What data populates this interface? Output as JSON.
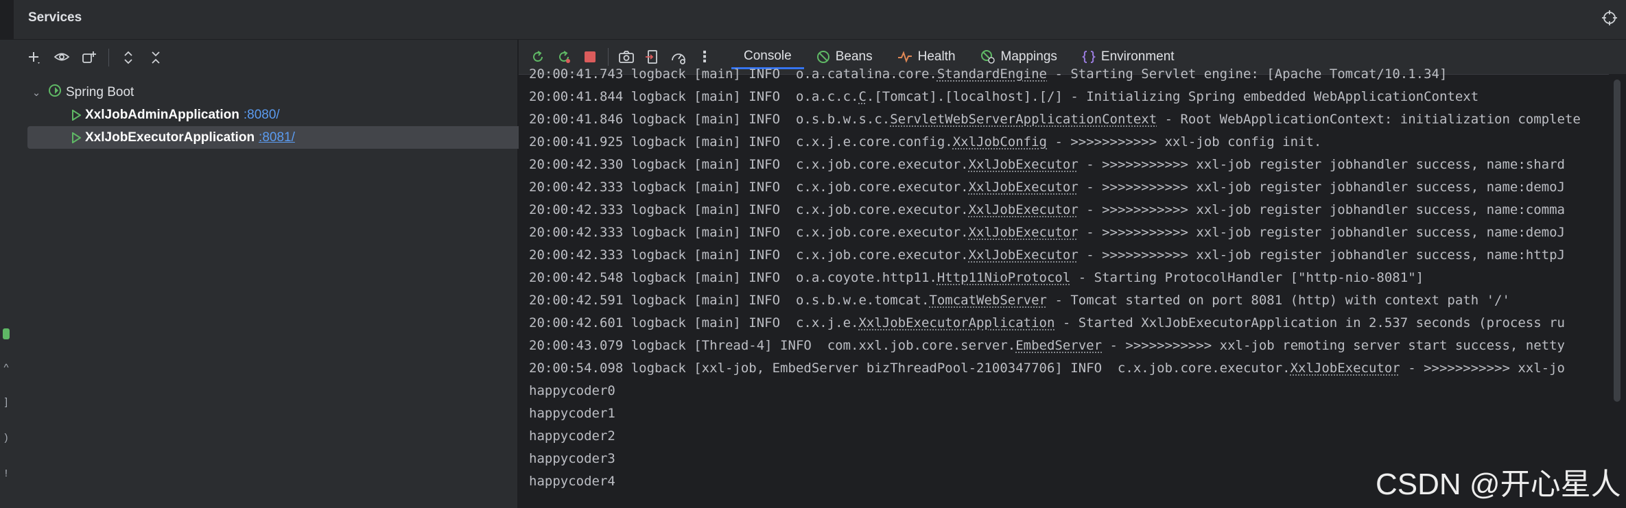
{
  "panel": {
    "title": "Services"
  },
  "left_toolbar": {
    "buttons": [
      "add-icon",
      "eye-icon",
      "add-group-icon",
      "expand-all-icon",
      "collapse-all-icon"
    ]
  },
  "tree": {
    "group_label": "Spring Boot",
    "apps": [
      {
        "name": "XxlJobAdminApplication",
        "port": ":8080/",
        "selected": false
      },
      {
        "name": "XxlJobExecutorApplication",
        "port": ":8081/",
        "selected": true
      }
    ]
  },
  "right_toolbar": {
    "buttons": [
      "rerun-icon",
      "rerun-failed-icon",
      "stop-icon",
      "screenshot-icon",
      "exit-icon",
      "dashboard-icon",
      "more-icon"
    ],
    "tabs": [
      {
        "label": "Console",
        "icon": ""
      },
      {
        "label": "Beans",
        "icon": "beans-icon"
      },
      {
        "label": "Health",
        "icon": "health-icon"
      },
      {
        "label": "Mappings",
        "icon": "mappings-icon"
      },
      {
        "label": "Environment",
        "icon": "environment-icon"
      }
    ],
    "active_tab": "Console"
  },
  "console": {
    "lines": [
      {
        "time": "20:00:41.743",
        "pre": " logback [main] INFO  o.a.catalina.core.",
        "cls": "StandardEngine",
        "post": " - Starting Servlet engine: [Apache Tomcat/10.1.34]"
      },
      {
        "time": "20:00:41.844",
        "pre": " logback [main] INFO  o.a.c.c.",
        "cls": "C",
        "post": ".[Tomcat].[localhost].[/] - Initializing Spring embedded WebApplicationContext"
      },
      {
        "time": "20:00:41.846",
        "pre": " logback [main] INFO  o.s.b.w.s.c.",
        "cls": "ServletWebServerApplicationContext",
        "post": " - Root WebApplicationContext: initialization complete"
      },
      {
        "time": "20:00:41.925",
        "pre": " logback [main] INFO  c.x.j.e.core.config.",
        "cls": "XxlJobConfig",
        "post": " - >>>>>>>>>>> xxl-job config init."
      },
      {
        "time": "20:00:42.330",
        "pre": " logback [main] INFO  c.x.job.core.executor.",
        "cls": "XxlJobExecutor",
        "post": " - >>>>>>>>>>> xxl-job register jobhandler success, name:shard"
      },
      {
        "time": "20:00:42.333",
        "pre": " logback [main] INFO  c.x.job.core.executor.",
        "cls": "XxlJobExecutor",
        "post": " - >>>>>>>>>>> xxl-job register jobhandler success, name:demoJ"
      },
      {
        "time": "20:00:42.333",
        "pre": " logback [main] INFO  c.x.job.core.executor.",
        "cls": "XxlJobExecutor",
        "post": " - >>>>>>>>>>> xxl-job register jobhandler success, name:comma"
      },
      {
        "time": "20:00:42.333",
        "pre": " logback [main] INFO  c.x.job.core.executor.",
        "cls": "XxlJobExecutor",
        "post": " - >>>>>>>>>>> xxl-job register jobhandler success, name:demoJ"
      },
      {
        "time": "20:00:42.333",
        "pre": " logback [main] INFO  c.x.job.core.executor.",
        "cls": "XxlJobExecutor",
        "post": " - >>>>>>>>>>> xxl-job register jobhandler success, name:httpJ"
      },
      {
        "time": "20:00:42.548",
        "pre": " logback [main] INFO  o.a.coyote.http11.",
        "cls": "Http11NioProtocol",
        "post": " - Starting ProtocolHandler [\"http-nio-8081\"]"
      },
      {
        "time": "20:00:42.591",
        "pre": " logback [main] INFO  o.s.b.w.e.tomcat.",
        "cls": "TomcatWebServer",
        "post": " - Tomcat started on port 8081 (http) with context path '/'"
      },
      {
        "time": "20:00:42.601",
        "pre": " logback [main] INFO  c.x.j.e.",
        "cls": "XxlJobExecutorApplication",
        "post": " - Started XxlJobExecutorApplication in 2.537 seconds (process ru"
      },
      {
        "time": "20:00:43.079",
        "pre": " logback [Thread-4] INFO  com.xxl.job.core.server.",
        "cls": "EmbedServer",
        "post": " - >>>>>>>>>>> xxl-job remoting server start success, netty"
      },
      {
        "time": "20:00:54.098",
        "pre": " logback [xxl-job, EmbedServer bizThreadPool-2100347706] INFO  c.x.job.core.executor.",
        "cls": "XxlJobExecutor",
        "post": " - >>>>>>>>>>> xxl-jo"
      },
      {
        "time": "",
        "pre": "happycoder0",
        "cls": "",
        "post": ""
      },
      {
        "time": "",
        "pre": "happycoder1",
        "cls": "",
        "post": ""
      },
      {
        "time": "",
        "pre": "happycoder2",
        "cls": "",
        "post": ""
      },
      {
        "time": "",
        "pre": "happycoder3",
        "cls": "",
        "post": ""
      },
      {
        "time": "",
        "pre": "happycoder4",
        "cls": "",
        "post": ""
      }
    ]
  },
  "watermark": "CSDN @开心星人",
  "colors": {
    "accent": "#3574f0",
    "run_green": "#5fb865",
    "stop_red": "#db5c5c",
    "link_blue": "#5b9bf0"
  }
}
